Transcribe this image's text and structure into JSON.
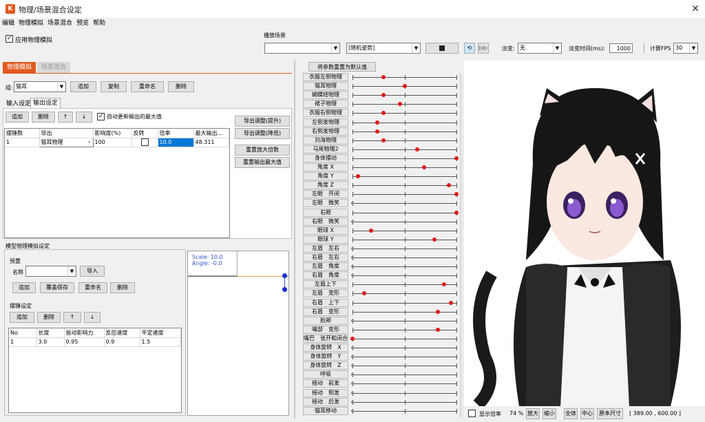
{
  "window": {
    "title": "物理/场景混合设定",
    "app_icon": "K",
    "close": "✕"
  },
  "menu": [
    "编辑",
    "物理模拟",
    "场景混合",
    "预览",
    "帮助"
  ],
  "enable_physics": {
    "label": "应用物理模拟",
    "checked": true
  },
  "playback": {
    "section_label": "播放场景",
    "scene_value": "",
    "motion_value": "[随机姿势]",
    "fade_label": "淡变:",
    "fade_value": "无",
    "fade_time_label": "淡变时间(ms):",
    "fade_time_value": "1000",
    "fps_label": "计算FPS",
    "fps_value": "30"
  },
  "left_tabs": [
    "物理模拟",
    "场景混合"
  ],
  "group": {
    "label": "组:",
    "value": "猫耳",
    "buttons": [
      "追加",
      "复制",
      "重命名",
      "删除"
    ]
  },
  "sub_tabs": [
    "输入设定",
    "输出设定"
  ],
  "output_toolbar": {
    "buttons": [
      "追加",
      "删除",
      "↑",
      "↓"
    ],
    "auto_update_label": "自动更新输出的最大值"
  },
  "output_table": {
    "headers": [
      "摆锤数",
      "导出",
      "影响度(%)",
      "反转",
      "倍率",
      "最大输出..."
    ],
    "rows": [
      [
        "1",
        "猫耳物理",
        "100",
        "",
        "10.0",
        "48.311"
      ]
    ]
  },
  "side_buttons": [
    "导出调整(提升)",
    "导出调整(降低)",
    "重置放大倍数",
    "重置输出最大值"
  ],
  "model_sim": {
    "section_label": "模型物理模拟设定",
    "preset_label": "预置",
    "name_label": "名称",
    "import_button": "导入",
    "preset_buttons": [
      "追加",
      "覆盖保存",
      "重命名",
      "删除"
    ],
    "pendulum_label": "摆锤设定",
    "pendulum_buttons": [
      "追加",
      "删除",
      "↑",
      "↓"
    ],
    "table_headers": [
      "No",
      "长度",
      "振动影响力",
      "反应速度",
      "平定速度"
    ],
    "table_rows": [
      [
        "1",
        "3.0",
        "0.95",
        "0.9",
        "1.5"
      ]
    ]
  },
  "preview_info": {
    "scale": "Scale: 10.0",
    "angle": "Angle: -0.0"
  },
  "reset_params_button": "将参数重置为默认值",
  "params": [
    {
      "name": "衣服左侧物理",
      "value": 0.3
    },
    {
      "name": "猫耳物理",
      "value": 0.5
    },
    {
      "name": "蝴蝶结物理",
      "value": 0.3
    },
    {
      "name": "裙子物理",
      "value": 0.46
    },
    {
      "name": "衣服右侧物理",
      "value": 0.3
    },
    {
      "name": "左侧发物理",
      "value": 0.24
    },
    {
      "name": "右侧发物理",
      "value": 0.24
    },
    {
      "name": "刘海物理",
      "value": 0.3
    },
    {
      "name": "马尾物理2",
      "value": 0.62
    },
    {
      "name": "身体摆动",
      "value": 1.0
    },
    {
      "name": "角度 X",
      "value": 0.69
    },
    {
      "name": "角度 Y",
      "value": 0.05
    },
    {
      "name": "角度 Z",
      "value": 0.93
    },
    {
      "name": "左眼　开闭",
      "value": 1.0
    },
    {
      "name": "左眼　微笑",
      "value": 0.0
    },
    {
      "name": "右眼",
      "value": 1.0
    },
    {
      "name": "右眼　微笑",
      "value": 0.0
    },
    {
      "name": "眼球 X",
      "value": 0.18
    },
    {
      "name": "眼球 Y",
      "value": 0.79
    },
    {
      "name": "左眉　左右",
      "value": 0.0
    },
    {
      "name": "右眉　左右",
      "value": 0.0
    },
    {
      "name": "左眉　角度",
      "value": 0.0
    },
    {
      "name": "右眉　角度",
      "value": 0.0
    },
    {
      "name": "左眉上下",
      "value": 0.88
    },
    {
      "name": "左眉　变形",
      "value": 0.11
    },
    {
      "name": "右眉　上下",
      "value": 0.95
    },
    {
      "name": "右眉　变形",
      "value": 0.82
    },
    {
      "name": "脸颊",
      "value": 0.0
    },
    {
      "name": "嘴部　变形",
      "value": 0.82
    },
    {
      "name": "嘴巴　张开和闭合",
      "value": 0.0
    },
    {
      "name": "身体旋转　X",
      "value": 0.0
    },
    {
      "name": "身体旋转　Y",
      "value": 0.0
    },
    {
      "name": "身体旋转　Z",
      "value": 0.0
    },
    {
      "name": "呼吸",
      "value": 0.0
    },
    {
      "name": "摇动　前发",
      "value": 0.0
    },
    {
      "name": "摇动　侧发",
      "value": 0.0
    },
    {
      "name": "摇动　后发",
      "value": 0.0
    },
    {
      "name": "猫耳移动",
      "value": 0.0
    }
  ],
  "status": {
    "show_grid_label": "显示倍率",
    "zoom": "74 %",
    "buttons": [
      "放大",
      "缩小",
      "全体",
      "中心",
      "原本尺寸"
    ],
    "coords": "[ 389.00 , 600.00 ]"
  },
  "colors": {
    "accent": "#e05a1e",
    "knob": "#e01818",
    "selection": "#0078d7"
  }
}
